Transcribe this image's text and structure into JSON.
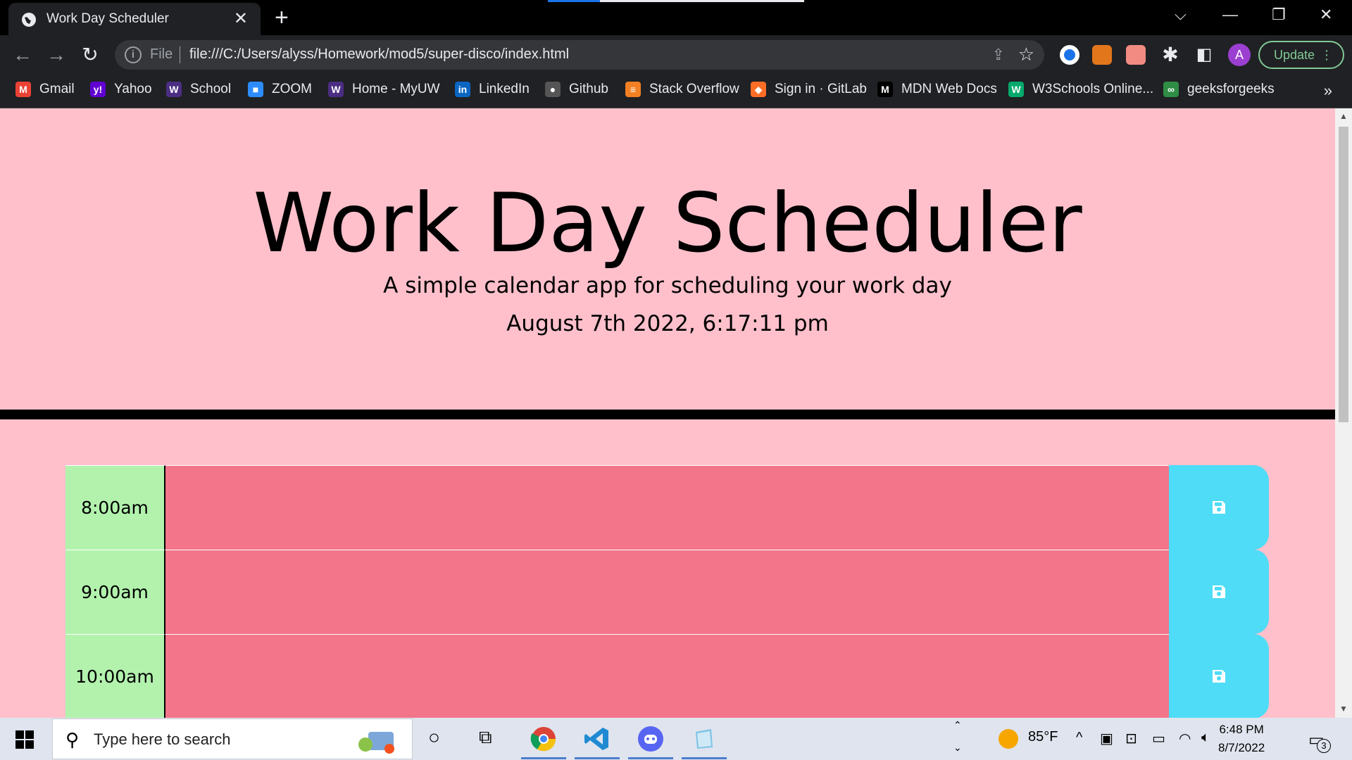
{
  "browser": {
    "tab_title": "Work Day Scheduler",
    "url_scheme": "File",
    "url": "file:///C:/Users/alyss/Homework/mod5/super-disco/index.html",
    "update_label": "Update",
    "avatar_letter": "A"
  },
  "bookmarks": [
    {
      "label": "Gmail",
      "icon": "M",
      "color": "#ea4335"
    },
    {
      "label": "Yahoo",
      "icon": "y!",
      "color": "#6001d2"
    },
    {
      "label": "School",
      "icon": "W",
      "color": "#4b2e83"
    },
    {
      "label": "ZOOM",
      "icon": "■",
      "color": "#2d8cff"
    },
    {
      "label": "Home - MyUW",
      "icon": "W",
      "color": "#4b2e83"
    },
    {
      "label": "LinkedIn",
      "icon": "in",
      "color": "#0a66c2"
    },
    {
      "label": "Github",
      "icon": "●",
      "color": "#555"
    },
    {
      "label": "Stack Overflow",
      "icon": "≡",
      "color": "#f48024"
    },
    {
      "label": "Sign in · GitLab",
      "icon": "◆",
      "color": "#fc6d26"
    },
    {
      "label": "MDN Web Docs",
      "icon": "M",
      "color": "#000"
    },
    {
      "label": "W3Schools Online...",
      "icon": "W",
      "color": "#04aa6d"
    },
    {
      "label": "geeksforgeeks",
      "icon": "∞",
      "color": "#2f8d46"
    }
  ],
  "header": {
    "title": "Work Day Scheduler",
    "lead": "A simple calendar app for scheduling your work day",
    "current_day": "August 7th 2022, 6:17:11 pm"
  },
  "timeblocks": [
    {
      "hour": "8:00am",
      "description": ""
    },
    {
      "hour": "9:00am",
      "description": ""
    },
    {
      "hour": "10:00am",
      "description": ""
    }
  ],
  "colors": {
    "page_bg": "#ffc0cb",
    "hour_bg": "#b2f2ad",
    "past_bg": "#f2758a",
    "save_bg": "#4edcf6"
  },
  "taskbar": {
    "search_placeholder": "Type here to search",
    "temperature": "85°F",
    "time": "6:48 PM",
    "date": "8/7/2022",
    "notification_count": "3"
  }
}
